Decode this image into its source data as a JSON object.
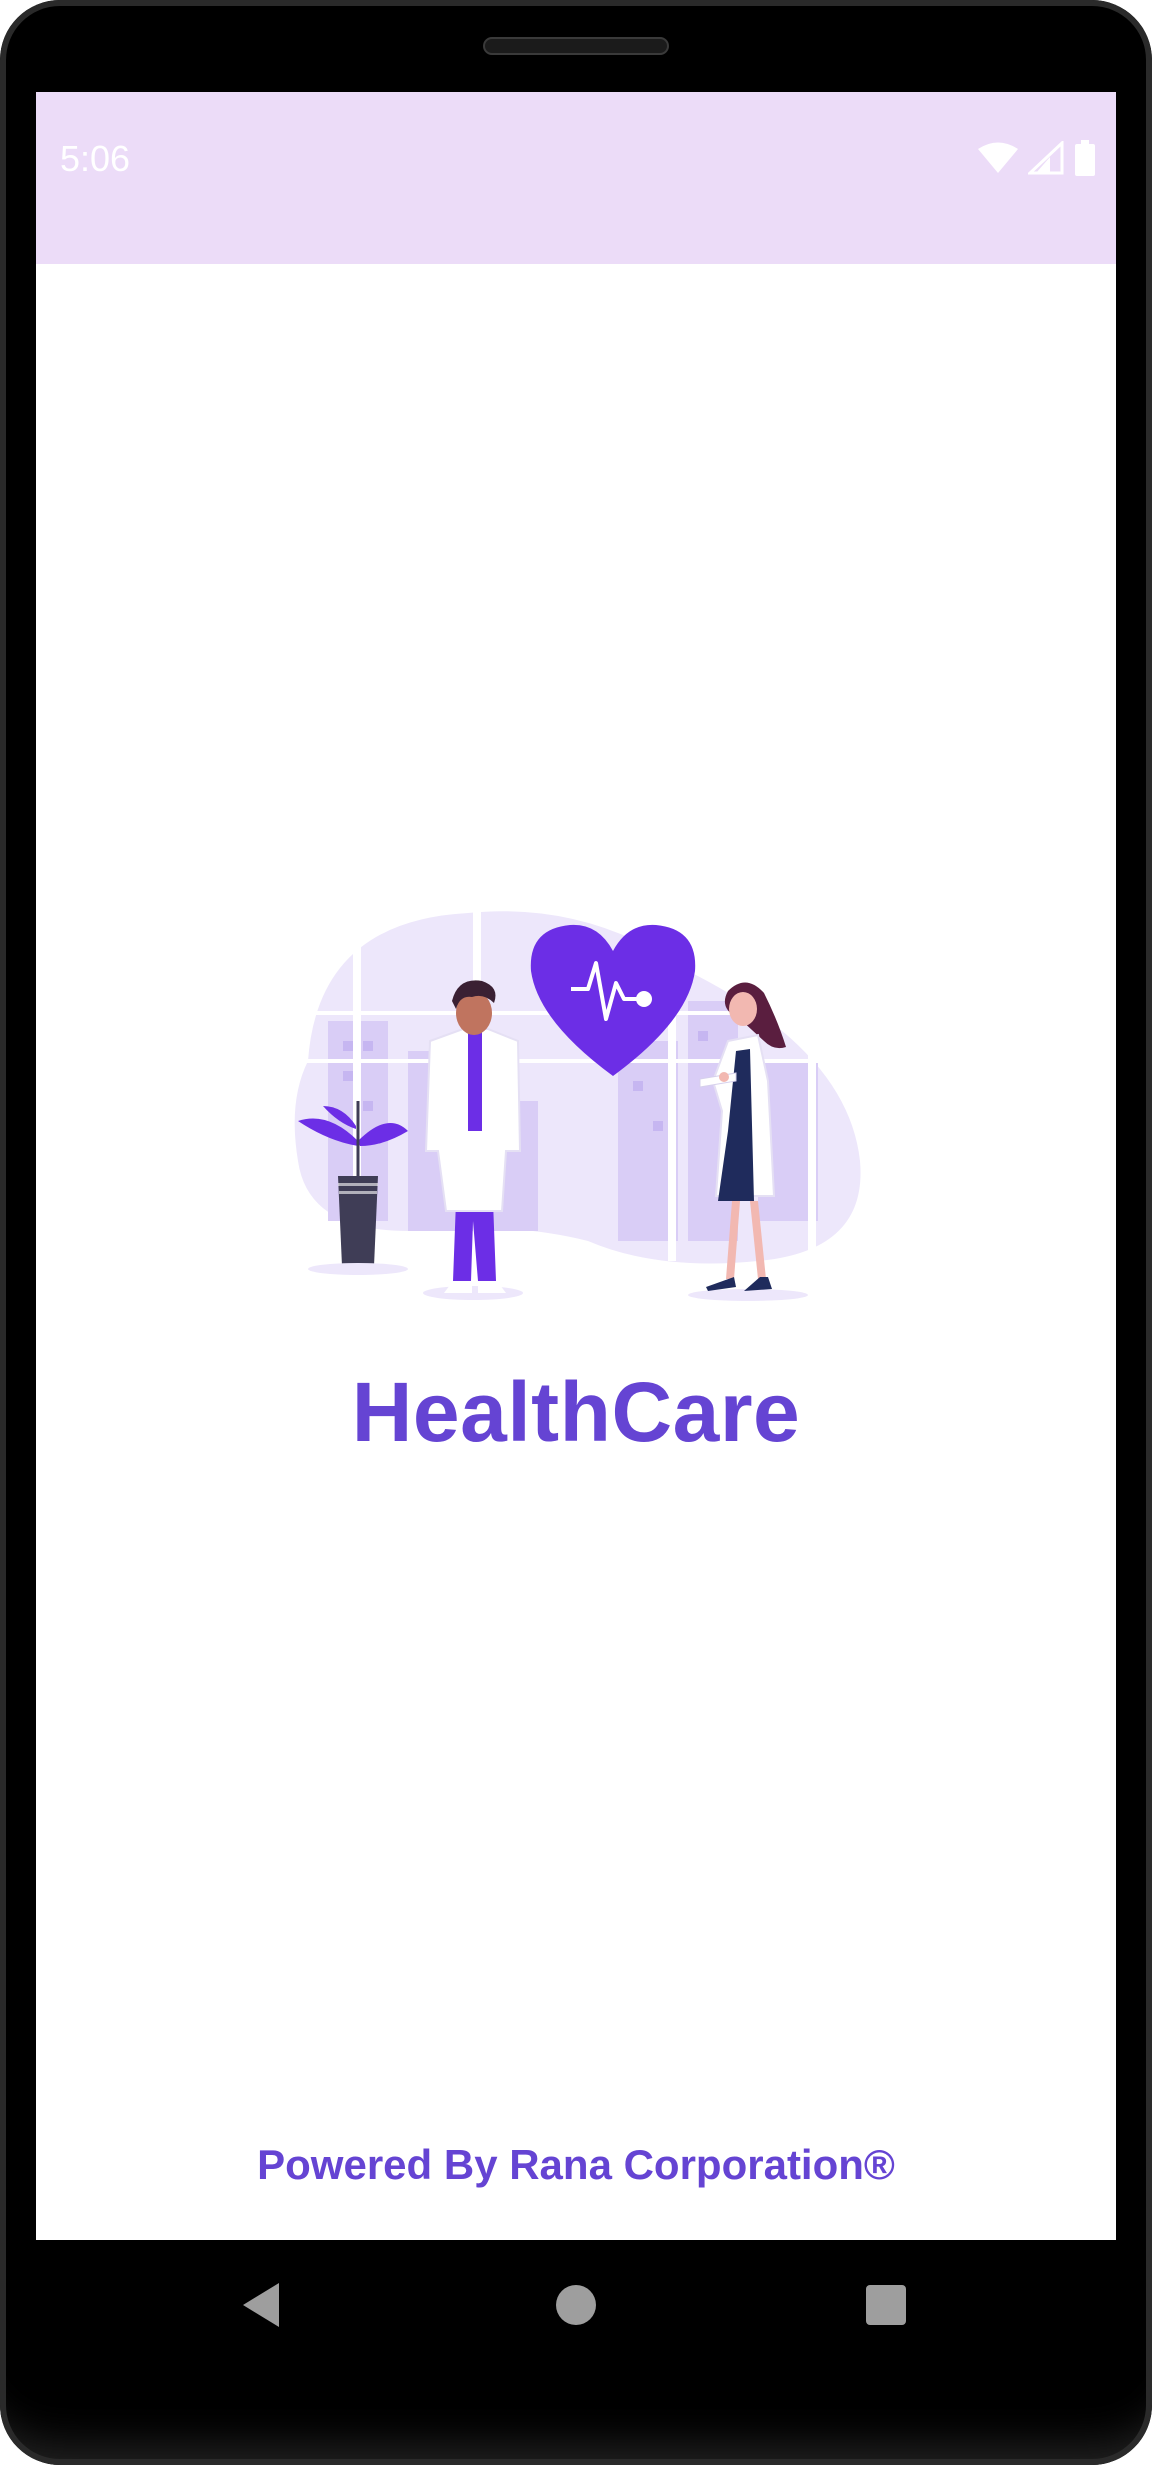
{
  "status_bar": {
    "time": "5:06",
    "icons": [
      "wifi-icon",
      "signal-icon",
      "battery-icon"
    ]
  },
  "splash": {
    "illustration": "doctors-heart-illustration",
    "app_title": "HealthCare",
    "powered_by": "Powered By Rana Corporation®"
  },
  "navigation": {
    "buttons": [
      "back-icon",
      "home-icon",
      "recents-icon"
    ]
  },
  "colors": {
    "accent": "#6544d3",
    "status_bar_bg": "#ecdcf8",
    "heart": "#6c2ee6",
    "background": "#ffffff"
  }
}
